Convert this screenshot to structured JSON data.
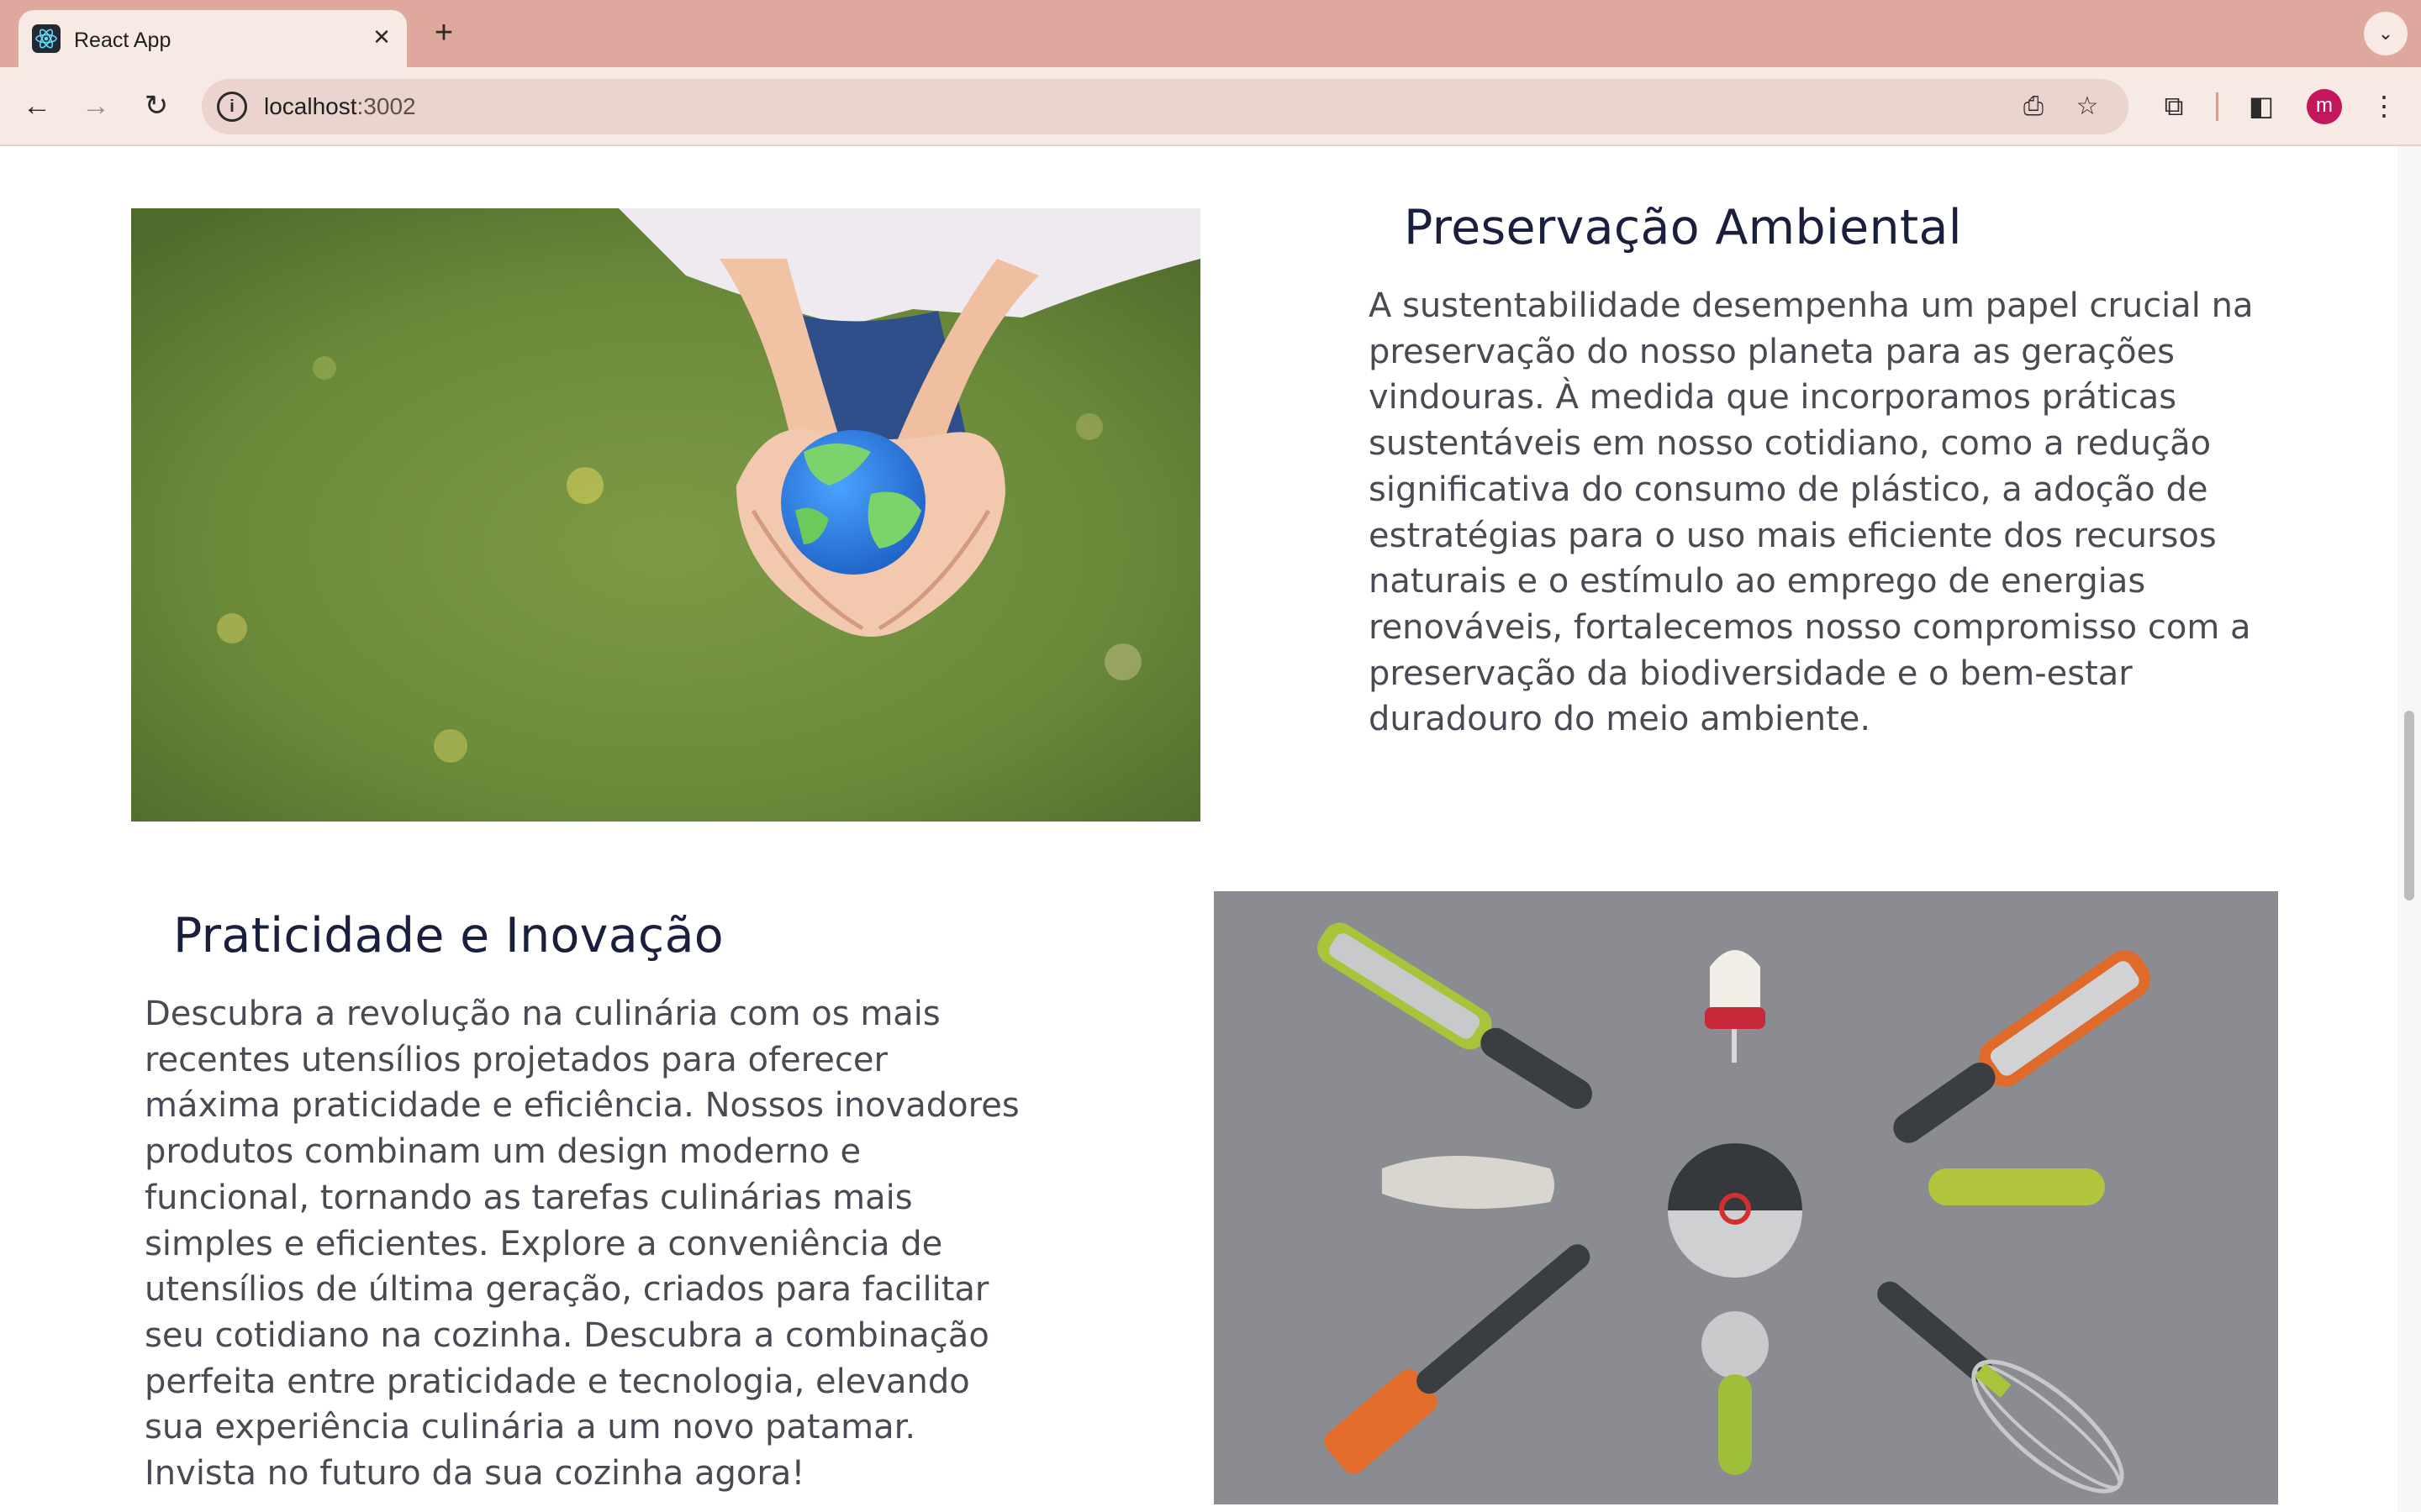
{
  "browser": {
    "tab": {
      "title": "React App"
    },
    "address_bar": {
      "host": "localhost",
      "port": ":3002"
    },
    "profile_initial": "m"
  },
  "icons": {
    "favicon": "react-logo-icon",
    "tab_close": "close-icon",
    "new_tab": "plus-icon",
    "tab_search": "chevron-down-icon",
    "back": "arrow-left-icon",
    "forward": "arrow-right-icon",
    "reload": "reload-icon",
    "site_info": "info-icon",
    "install": "install-app-icon",
    "bookmark": "star-icon",
    "extensions": "puzzle-icon",
    "side_panel": "side-panel-icon",
    "menu": "kebab-menu-icon"
  },
  "colors": {
    "tabbar": "#dea99c",
    "toolbar": "#f7e9e4",
    "heading": "#1a1f3d",
    "body_text": "#4a4a55",
    "avatar": "#c2185b"
  },
  "sections": [
    {
      "heading": "Preservação Ambiental",
      "lines": [
        "A sustentabilidade desempenha um papel crucial na",
        "preservação do nosso planeta para as gerações",
        "vindouras. À medida que incorporamos práticas",
        "sustentáveis em nosso cotidiano, como a redução",
        "significativa do consumo de plástico, a adoção de",
        "estratégias para o uso mais eficiente dos recursos",
        "naturais e o estímulo ao emprego de energias",
        "renováveis, fortalecemos nosso compromisso com a",
        "preservação da biodiversidade e o bem-estar",
        "duradouro do meio ambiente."
      ]
    },
    {
      "heading": "Praticidade e Inovação",
      "lines": [
        "Descubra a revolução na culinária com os mais",
        "recentes utensílios projetados para oferecer",
        "máxima praticidade e eficiência. Nossos inovadores",
        "produtos combinam um design moderno e",
        "funcional, tornando as tarefas culinárias mais",
        "simples e eficientes. Explore a conveniência de",
        "utensílios de última geração, criados para facilitar",
        "seu cotidiano na cozinha. Descubra a combinação",
        "perfeita entre praticidade e tecnologia, elevando",
        "sua experiência culinária a um novo patamar.",
        "Invista no futuro da sua cozinha agora!"
      ]
    }
  ]
}
